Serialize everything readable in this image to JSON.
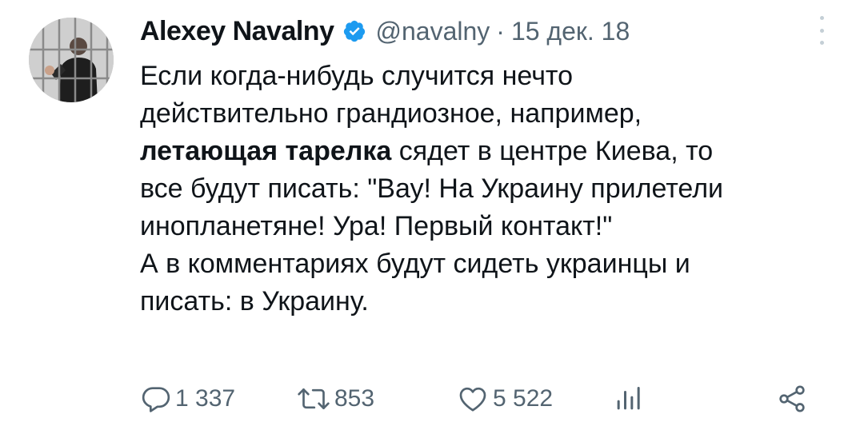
{
  "author": {
    "name": "Alexey Navalny",
    "handle": "@navalny",
    "separator": "·",
    "date": "15 дек. 18"
  },
  "tweet": {
    "line1": "Если когда-нибудь случится нечто",
    "line2": "действительно грандиозное, например,",
    "bold_phrase": "летающая тарелка",
    "line3_rest": " сядет в центре Киева, то",
    "line4": "все будут писать: \"Вау! На Украину прилетели",
    "line5": "инопланетяне! Ура! Первый контакт!\"",
    "line6": "А в комментариях будут сидеть украинцы и",
    "line7": "писать: в Украину."
  },
  "actions": {
    "replies": "1 337",
    "retweets": "853",
    "likes": "5 522"
  },
  "colors": {
    "text": "#0f1419",
    "secondary": "#536471",
    "verified": "#1d9bf0"
  },
  "icons": [
    "verified-badge-icon",
    "more-icon",
    "reply-icon",
    "retweet-icon",
    "like-icon",
    "views-icon",
    "share-icon"
  ]
}
